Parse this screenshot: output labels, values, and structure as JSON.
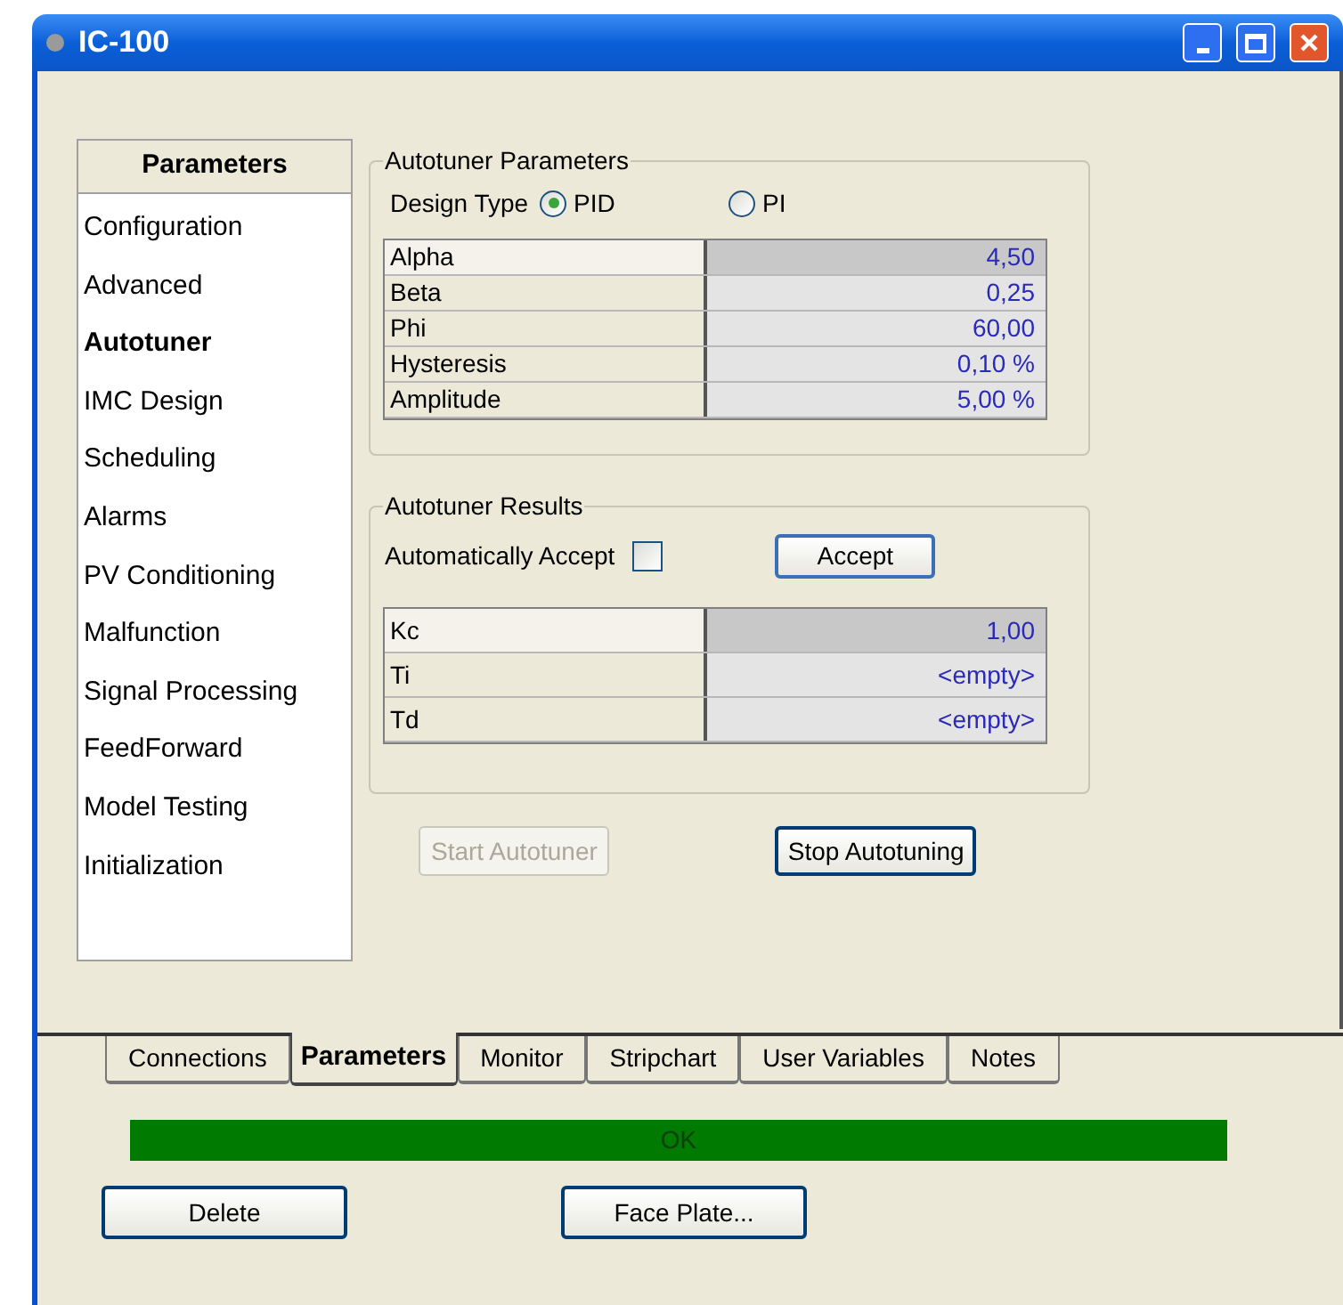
{
  "window": {
    "title": "IC-100"
  },
  "sidebar": {
    "header": "Parameters",
    "items": [
      {
        "label": "Configuration",
        "selected": false
      },
      {
        "label": "Advanced",
        "selected": false
      },
      {
        "label": "Autotuner",
        "selected": true
      },
      {
        "label": "IMC Design",
        "selected": false
      },
      {
        "label": "Scheduling",
        "selected": false
      },
      {
        "label": "Alarms",
        "selected": false
      },
      {
        "label": "PV Conditioning",
        "selected": false
      },
      {
        "label": "Malfunction",
        "selected": false
      },
      {
        "label": "Signal Processing",
        "selected": false
      },
      {
        "label": "FeedForward",
        "selected": false
      },
      {
        "label": "Model Testing",
        "selected": false
      },
      {
        "label": "Initialization",
        "selected": false
      }
    ]
  },
  "autotuner_parameters": {
    "title": "Autotuner Parameters",
    "design_type_label": "Design Type",
    "design_types": [
      {
        "label": "PID",
        "selected": true
      },
      {
        "label": "PI",
        "selected": false
      }
    ],
    "rows": [
      {
        "name": "Alpha",
        "value": "4,50",
        "selected": true
      },
      {
        "name": "Beta",
        "value": "0,25",
        "selected": false
      },
      {
        "name": "Phi",
        "value": "60,00",
        "selected": false
      },
      {
        "name": "Hysteresis",
        "value": "0,10 %",
        "selected": false
      },
      {
        "name": "Amplitude",
        "value": "5,00 %",
        "selected": false
      }
    ]
  },
  "autotuner_results": {
    "title": "Autotuner Results",
    "auto_accept": {
      "label": "Automatically Accept",
      "checked": false
    },
    "accept_button": "Accept",
    "rows": [
      {
        "name": "Kc",
        "value": "1,00",
        "selected": true
      },
      {
        "name": "Ti",
        "value": "<empty>",
        "selected": false
      },
      {
        "name": "Td",
        "value": "<empty>",
        "selected": false
      }
    ]
  },
  "actions": [
    {
      "label": "Start Autotuner",
      "disabled": true
    },
    {
      "label": "Stop Autotuning",
      "disabled": false
    }
  ],
  "tabs": [
    {
      "label": "Connections",
      "selected": false
    },
    {
      "label": "Parameters",
      "selected": true
    },
    {
      "label": "Monitor",
      "selected": false
    },
    {
      "label": "Stripchart",
      "selected": false
    },
    {
      "label": "User Variables",
      "selected": false
    },
    {
      "label": "Notes",
      "selected": false
    }
  ],
  "status": {
    "text": "OK"
  },
  "buttons": [
    "Delete",
    "Face Plate..."
  ]
}
